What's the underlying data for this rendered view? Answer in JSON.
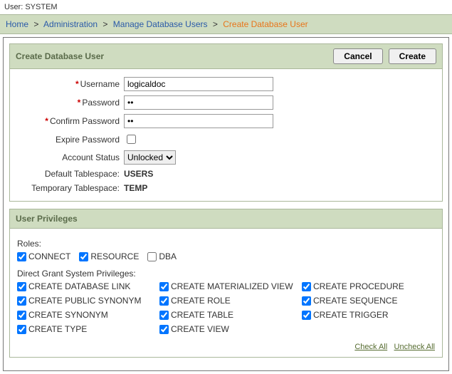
{
  "user_bar": {
    "label": "User:",
    "value": "SYSTEM"
  },
  "breadcrumb": {
    "items": [
      "Home",
      "Administration",
      "Manage Database Users"
    ],
    "current": "Create Database User",
    "sep": ">"
  },
  "panel1": {
    "title": "Create Database User",
    "buttons": {
      "cancel": "Cancel",
      "create": "Create"
    },
    "fields": {
      "username": {
        "label": "Username",
        "value": "logicaldoc",
        "required": true
      },
      "password": {
        "label": "Password",
        "value": "••",
        "required": true
      },
      "confirm_password": {
        "label": "Confirm Password",
        "value": "••",
        "required": true
      },
      "expire_password": {
        "label": "Expire Password",
        "checked": false
      },
      "account_status": {
        "label": "Account Status",
        "value": "Unlocked"
      },
      "default_tablespace": {
        "label": "Default Tablespace:",
        "value": "USERS"
      },
      "temporary_tablespace": {
        "label": "Temporary Tablespace:",
        "value": "TEMP"
      }
    }
  },
  "panel2": {
    "title": "User Privileges",
    "roles_label": "Roles:",
    "roles": [
      {
        "label": "CONNECT",
        "checked": true
      },
      {
        "label": "RESOURCE",
        "checked": true
      },
      {
        "label": "DBA",
        "checked": false
      }
    ],
    "direct_label": "Direct Grant System Privileges:",
    "privs": {
      "col1": [
        {
          "label": "CREATE DATABASE LINK",
          "checked": true
        },
        {
          "label": "CREATE PUBLIC SYNONYM",
          "checked": true
        },
        {
          "label": "CREATE SYNONYM",
          "checked": true
        },
        {
          "label": "CREATE TYPE",
          "checked": true
        }
      ],
      "col2": [
        {
          "label": "CREATE MATERIALIZED VIEW",
          "checked": true
        },
        {
          "label": "CREATE ROLE",
          "checked": true
        },
        {
          "label": "CREATE TABLE",
          "checked": true
        },
        {
          "label": "CREATE VIEW",
          "checked": true
        }
      ],
      "col3": [
        {
          "label": "CREATE PROCEDURE",
          "checked": true
        },
        {
          "label": "CREATE SEQUENCE",
          "checked": true
        },
        {
          "label": "CREATE TRIGGER",
          "checked": true
        }
      ]
    },
    "links": {
      "check_all": "Check All",
      "uncheck_all": "Uncheck All"
    }
  }
}
